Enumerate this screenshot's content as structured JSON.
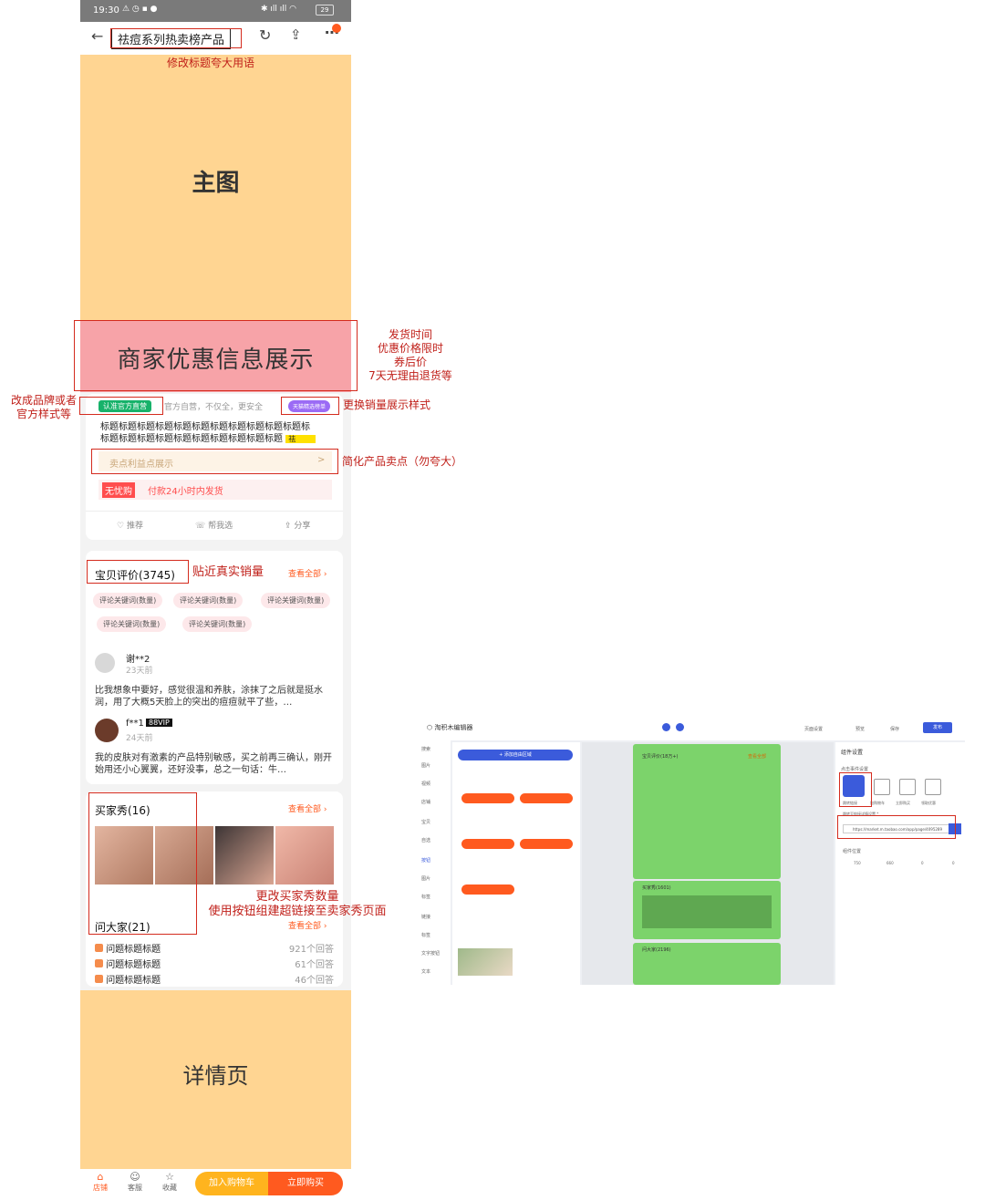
{
  "status": {
    "time": "19:30",
    "battery": "29"
  },
  "nav": {
    "title": "祛痘系列热卖榜产品"
  },
  "annotations": {
    "title_note": "修改标题夸大用语",
    "main_image": "主图",
    "promo_block": "商家优惠信息展示",
    "promo_note": [
      "发货时间",
      "优惠价格限时",
      "券后价",
      "7天无理由退货等"
    ],
    "brand_note": [
      "改成品牌或者",
      "官方样式等"
    ],
    "sales_note": "更换销量展示样式",
    "selling_note": "简化产品卖点（勿夸大）",
    "reviews_note": "贴近真实销量",
    "buyer_show_note": [
      "更改买家秀数量",
      "使用按钮组建超链接至卖家秀页面"
    ],
    "detail_page": "详情页"
  },
  "product": {
    "official_badge": "认准官方直营",
    "official_text": "官方自营，不仅全，更安全",
    "sales_badge": "天猫精选榜单",
    "title": [
      "标题标题标题标题标题标题标题标题标题标题标题标",
      "标题标题标题标题标题标题标题标题标题标题"
    ],
    "title_tag": "祛",
    "selling_points": "卖点利益点展示",
    "worry_free": "无忧购",
    "shipping": "付款24小时内发货",
    "actions": [
      "推荐",
      "帮我选",
      "分享"
    ]
  },
  "reviews": {
    "title": "宝贝评价(3745)",
    "see_all": "查看全部",
    "tags": [
      "评论关键词(数量)",
      "评论关键词(数量)",
      "评论关键词(数量)",
      "评论关键词(数量)",
      "评论关键词(数量)"
    ],
    "items": [
      {
        "user": "谢**2",
        "time": "23天前",
        "vip": "",
        "text": "比我想象中要好，感觉很温和养肤，涂抹了之后就是挺水润，用了大概5天脸上的突出的痘痘就平了些，…"
      },
      {
        "user": "f**1",
        "time": "24天前",
        "vip": "88VIP",
        "text": "我的皮肤对有激素的产品特别敏感，买之前再三确认，刚开始用还小心翼翼，还好没事，总之一句话：牛…"
      }
    ]
  },
  "buyer_show": {
    "title": "买家秀(16)",
    "see_all": "查看全部"
  },
  "qa": {
    "title": "问大家(21)",
    "see_all": "查看全部",
    "items": [
      {
        "q": "问题标题标题",
        "a": "921个回答"
      },
      {
        "q": "问题标题标题",
        "a": "61个回答"
      },
      {
        "q": "问题标题标题",
        "a": "46个回答"
      }
    ]
  },
  "bottom": {
    "icons": [
      "店铺",
      "客服",
      "收藏"
    ],
    "add_cart": "加入购物车",
    "buy_now": "立即购买"
  },
  "editor": {
    "app_title": "淘积木编辑器",
    "top_actions": [
      "页面设置",
      "预览",
      "保存",
      "发布"
    ],
    "add_module": "+ 添加自由区域",
    "sidebar": [
      "搜索",
      "图片",
      "视频",
      "店铺",
      "宝贝",
      "自选",
      "按钮",
      "图片",
      "标签",
      "链接",
      "标签",
      "文字按钮",
      "文本"
    ],
    "panel_title": "组件设置",
    "click_event": "点击事件设置",
    "event_types": [
      "跳转链接",
      "加购物车",
      "立即购买",
      "领取优惠"
    ],
    "link_label": "跳转至链接详情设置 *",
    "link_url": "https://market.m.taobao.com/app/page/4095289",
    "position_label": "组件位置",
    "position_values": {
      "w": "750",
      "h": "660",
      "x": "0",
      "y": "0"
    },
    "preview_blocks": [
      "宝贝评价(18万+)",
      "买家秀(1601)",
      "问大家(2196)"
    ],
    "see_all": "查看全部"
  },
  "colors": {
    "accent": "#ff5a1f",
    "yellow": "#ffd592",
    "pink": "#f7a3a8",
    "green": "#7cd36b",
    "annotation": "#d42b1e"
  }
}
